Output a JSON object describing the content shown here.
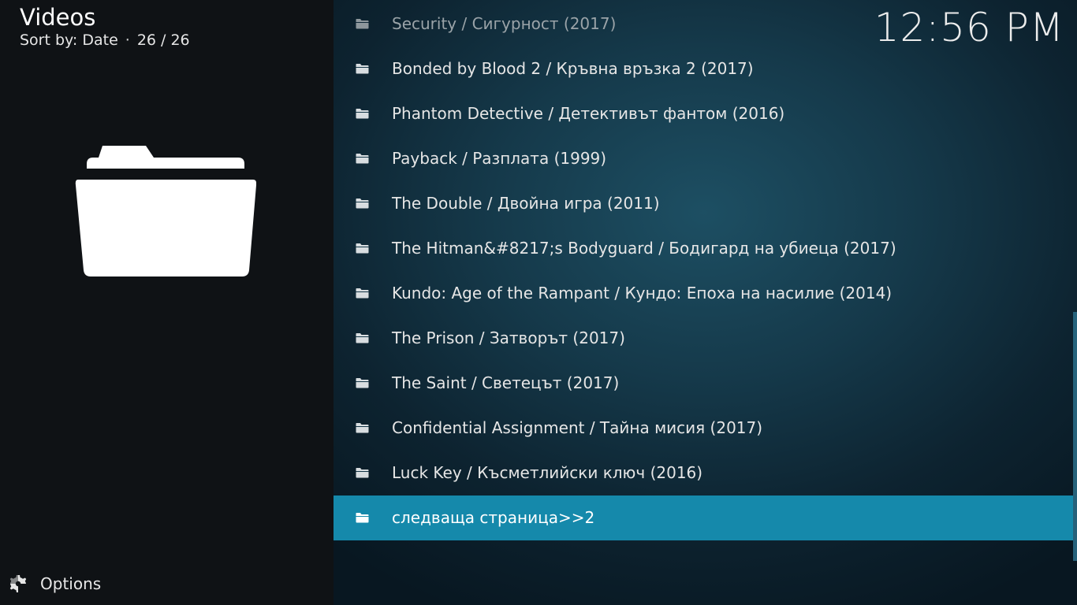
{
  "header": {
    "title": "Videos",
    "sort_label": "Sort by: Date",
    "separator": "·",
    "count": "26 / 26"
  },
  "clock": "12:56 PM",
  "options_label": "Options",
  "items": [
    {
      "label": "Security / Сигурност (2017)"
    },
    {
      "label": "Bonded by Blood 2 / Кръвна връзка 2 (2017)"
    },
    {
      "label": "Phantom Detective / Детективът фантом (2016)"
    },
    {
      "label": "Payback / Разплата (1999)"
    },
    {
      "label": "The Double / Двойна игра (2011)"
    },
    {
      "label": "The Hitman&#8217;s Bodyguard / Бодигард на убиеца (2017)"
    },
    {
      "label": "Kundo: Age of the Rampant / Кундо: Епоха на насилие (2014)"
    },
    {
      "label": "The Prison / Затворът (2017)"
    },
    {
      "label": "The Saint / Светецът (2017)"
    },
    {
      "label": "Confidential Assignment / Тайна мисия (2017)"
    },
    {
      "label": "Luck Key / Късметлийски ключ (2016)"
    },
    {
      "label": "следваща страница>>2",
      "selected": true
    }
  ],
  "colors": {
    "accent": "#1589ab",
    "left_panel": "#0f1215"
  },
  "icons": {
    "thumbnail": "folder-icon",
    "item": "folder-icon",
    "options": "options-gear-icon"
  }
}
